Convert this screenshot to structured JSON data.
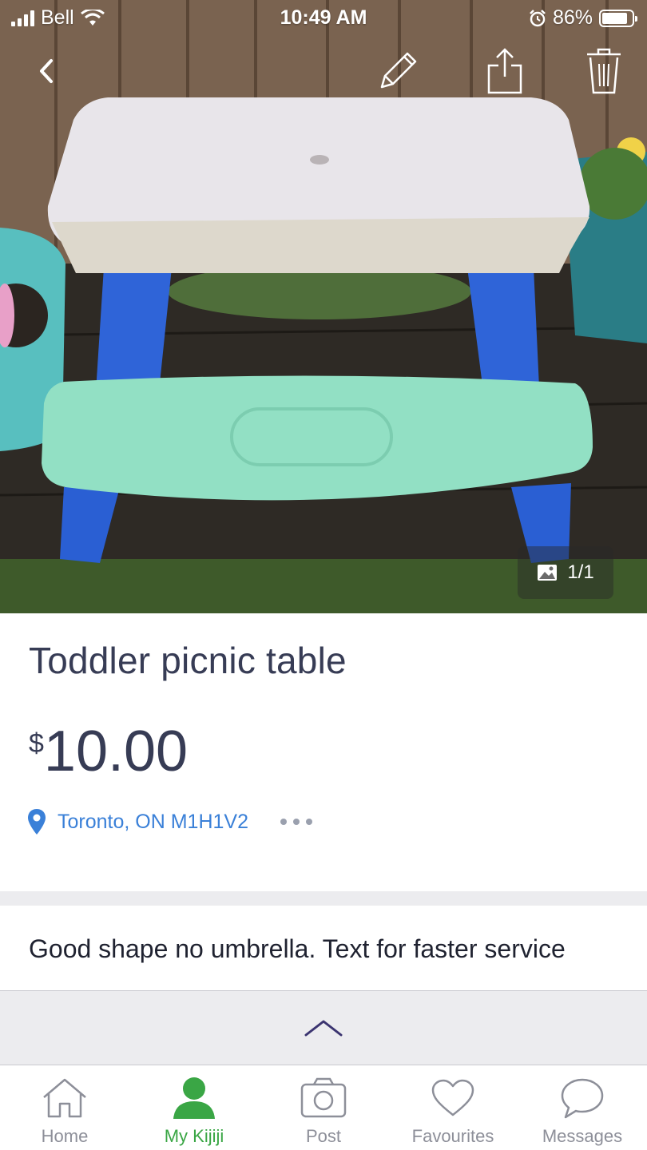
{
  "status_bar": {
    "carrier": "Bell",
    "time": "10:49 AM",
    "battery_percent": "86%",
    "battery_level": 0.86
  },
  "nav": {
    "icons": [
      "back-icon",
      "edit-icon",
      "share-icon",
      "trash-icon"
    ]
  },
  "photo": {
    "counter": "1/1"
  },
  "listing": {
    "title": "Toddler picnic table",
    "price_currency": "$",
    "price_amount": "10.00",
    "location": "Toronto, ON M1H1V2",
    "description": "Good shape no umbrella. Text for faster service"
  },
  "tabs": [
    {
      "label": "Home",
      "icon": "home-icon",
      "active": false
    },
    {
      "label": "My Kijiji",
      "icon": "profile-icon",
      "active": true
    },
    {
      "label": "Post",
      "icon": "camera-icon",
      "active": false
    },
    {
      "label": "Favourites",
      "icon": "heart-icon",
      "active": false
    },
    {
      "label": "Messages",
      "icon": "chat-icon",
      "active": false
    }
  ],
  "colors": {
    "title_text": "#373c55",
    "location_link": "#3a80d8",
    "active_tab": "#3aa645",
    "inactive_tab": "#8d8f99",
    "expand_chevron": "#3b3470"
  }
}
